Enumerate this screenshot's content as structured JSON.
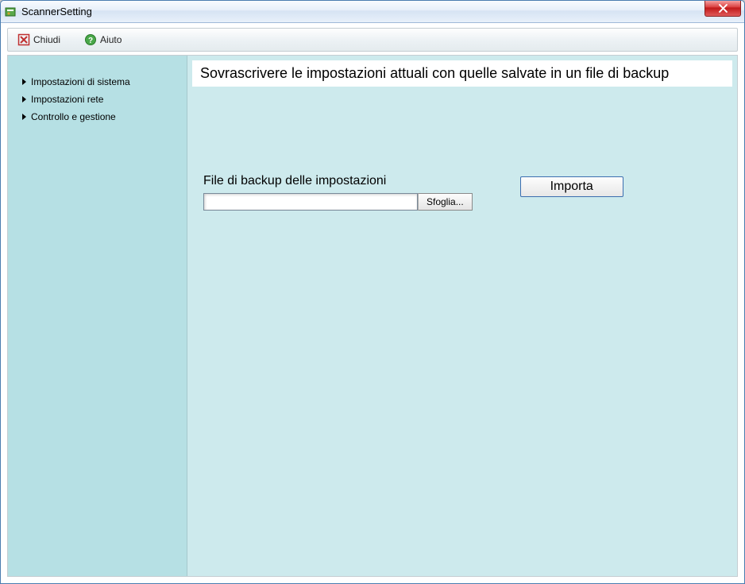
{
  "window": {
    "title": "ScannerSetting"
  },
  "toolbar": {
    "close_label": "Chiudi",
    "help_label": "Aiuto"
  },
  "sidebar": {
    "items": [
      {
        "label": "Impostazioni di sistema"
      },
      {
        "label": "Impostazioni rete"
      },
      {
        "label": "Controllo e gestione"
      }
    ]
  },
  "main": {
    "heading": "Sovrascrivere le impostazioni attuali con quelle salvate in un file di backup",
    "field_label": "File di backup delle impostazioni",
    "file_value": "",
    "browse_label": "Sfoglia...",
    "import_label": "Importa"
  }
}
